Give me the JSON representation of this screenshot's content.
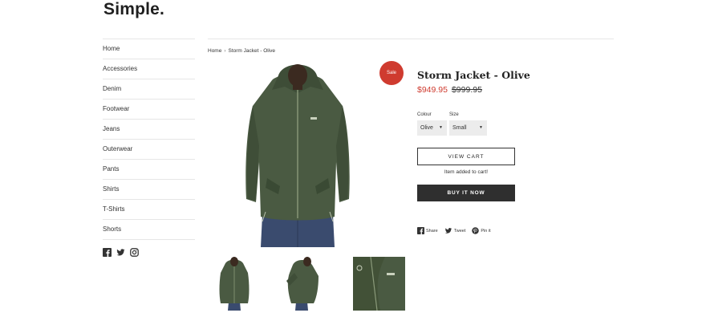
{
  "site": {
    "logo": "Simple."
  },
  "sidebar": {
    "items": [
      {
        "label": "Home"
      },
      {
        "label": "Accessories"
      },
      {
        "label": "Denim"
      },
      {
        "label": "Footwear"
      },
      {
        "label": "Jeans"
      },
      {
        "label": "Outerwear"
      },
      {
        "label": "Pants"
      },
      {
        "label": "Shirts"
      },
      {
        "label": "T-Shirts"
      },
      {
        "label": "Shorts"
      }
    ],
    "social_icons": [
      "facebook-icon",
      "twitter-icon",
      "instagram-icon"
    ]
  },
  "breadcrumb": {
    "home": "Home",
    "separator": "›",
    "current": "Storm Jacket - Olive"
  },
  "product": {
    "badge": "Sale",
    "title": "Storm Jacket - Olive",
    "sale_price": "$949.95",
    "original_price": "$999.95",
    "options": {
      "colour_label": "Colour",
      "colour_value": "Olive",
      "size_label": "Size",
      "size_value": "Small"
    },
    "view_cart_label": "VIEW CART",
    "added_message": "Item added to cart!",
    "buy_now_label": "BUY IT NOW",
    "share": {
      "facebook": "Share",
      "twitter": "Tweet",
      "pinterest": "Pin it"
    }
  },
  "colors": {
    "accent": "#cf3b2f",
    "jacket": "#4a5a42",
    "button_dark": "#2f2f2f"
  }
}
